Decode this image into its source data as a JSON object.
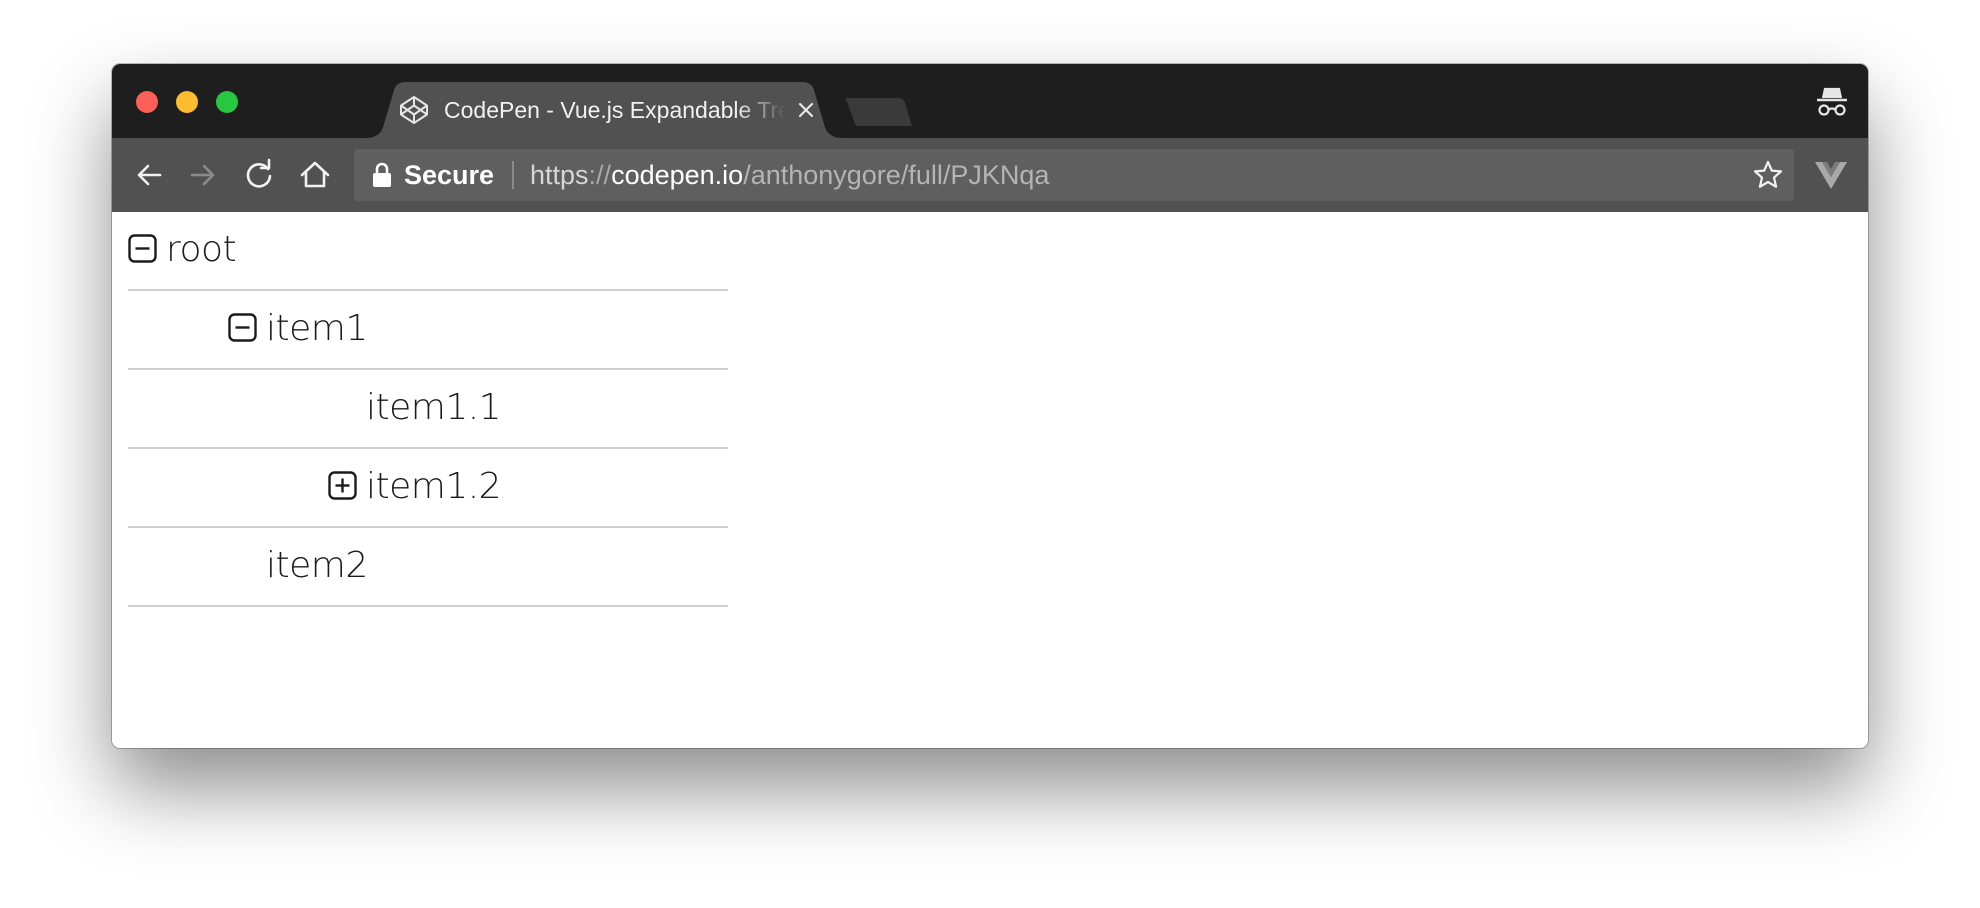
{
  "browser": {
    "tab": {
      "title": "CodePen - Vue.js Expandable Tree"
    },
    "address_bar": {
      "secure_label": "Secure",
      "url_scheme": "https",
      "url_separator": "://",
      "url_host": "codepen.io",
      "url_path": "/anthonygore/full/PJKNqa"
    },
    "colors": {
      "tabstrip": "#1e1e1f",
      "toolbar": "#515152",
      "active_tab": "#515152",
      "close": "#fe5f57",
      "minimize": "#febc2e",
      "maximize": "#27c840",
      "extension_badge": "#c96a66"
    },
    "icons": {
      "back": "arrow-left-icon",
      "forward": "arrow-right-icon",
      "reload": "reload-icon",
      "home": "home-icon",
      "lock": "lock-icon",
      "bookmark": "star-icon",
      "incognito": "incognito-icon",
      "favicon": "codepen-logo-icon",
      "vue_devtools": "vue-logo-icon",
      "screenshot_ext": "screen-capture-icon",
      "upload_ext": "upload-icon"
    }
  },
  "tree": {
    "nodes": [
      {
        "label": "root",
        "depth": 0,
        "toggle": "collapse"
      },
      {
        "label": "item1",
        "depth": 1,
        "toggle": "collapse"
      },
      {
        "label": "item1.1",
        "depth": 2,
        "toggle": "none"
      },
      {
        "label": "item1.2",
        "depth": 2,
        "toggle": "expand"
      },
      {
        "label": "item2",
        "depth": 1,
        "toggle": "none"
      }
    ]
  }
}
